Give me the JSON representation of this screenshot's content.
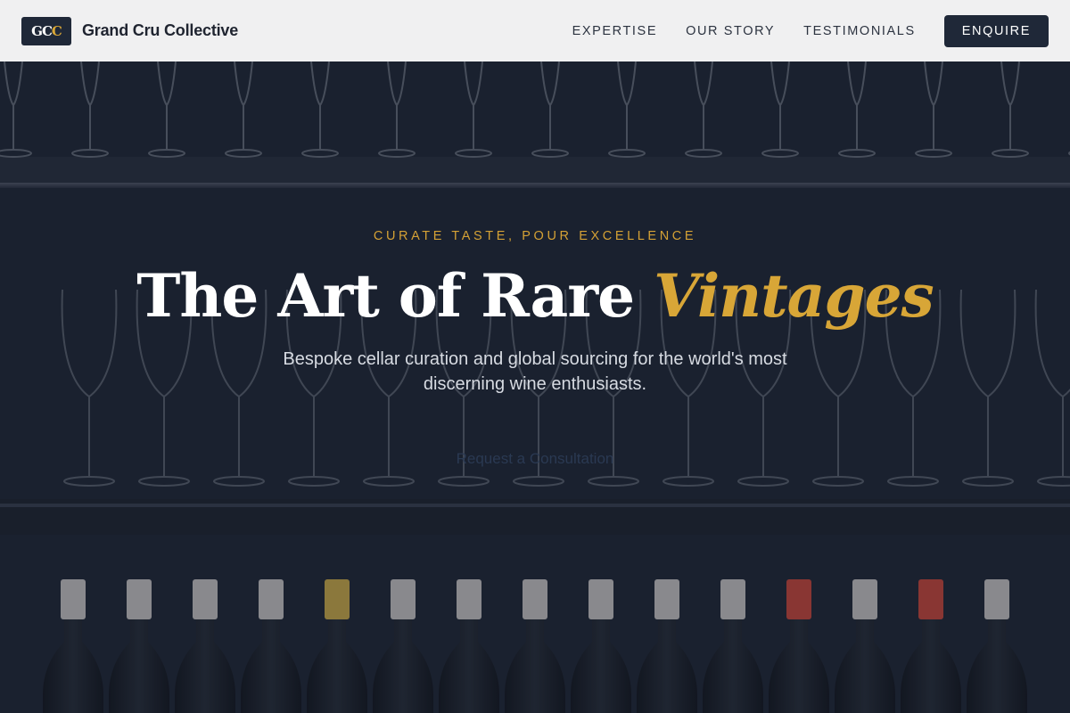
{
  "brand": {
    "logo_text_light": "GC",
    "logo_text_accent": "C",
    "name": "Grand Cru Collective"
  },
  "nav": {
    "items": [
      {
        "label": "EXPERTISE"
      },
      {
        "label": "OUR STORY"
      },
      {
        "label": "TESTIMONIALS"
      }
    ],
    "enquire_label": "ENQUIRE"
  },
  "hero": {
    "eyebrow": "CURATE TASTE, POUR EXCELLENCE",
    "headline_main": "The Art of Rare ",
    "headline_accent": "Vintages",
    "subtext": "Bespoke cellar curation and global sourcing for the world's most discerning wine enthusiasts.",
    "cta_label": "Request a Consultation",
    "background": "wine-glasses-and-bottles-photo"
  },
  "colors": {
    "header_bg": "#f0f0f1",
    "navy": "#1f2838",
    "gold": "#d8a637",
    "hero_text": "#ffffff"
  }
}
